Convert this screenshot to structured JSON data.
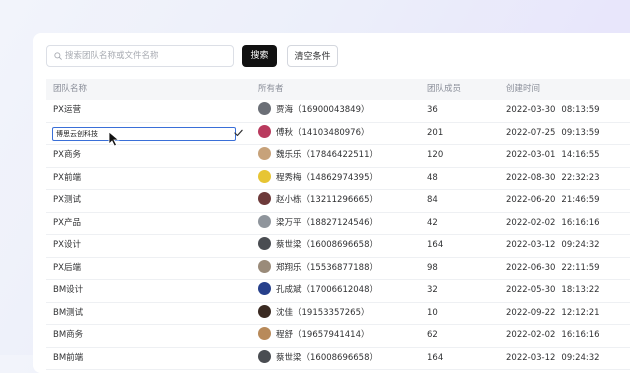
{
  "search": {
    "placeholder": "搜索团队名称或文件名称",
    "search_label": "搜索",
    "clear_label": "清空条件"
  },
  "table": {
    "headers": [
      "团队名称",
      "所有者",
      "团队成员",
      "创建时间"
    ],
    "editing_value": "博思云创科技",
    "rows": [
      {
        "name": "PX运营",
        "owner": "贾海（16900043849）",
        "members": "36",
        "date": "2022-03-30",
        "time": "08:13:59",
        "avatar": "#6b6f76"
      },
      {
        "name": "",
        "owner": "傅秋（14103480976）",
        "members": "201",
        "date": "2022-07-25",
        "time": "09:13:59",
        "avatar": "#b93a5e",
        "editing": true
      },
      {
        "name": "PX商务",
        "owner": "魏乐乐（17846422511）",
        "members": "120",
        "date": "2022-03-01",
        "time": "14:16:55",
        "avatar": "#c7a27a"
      },
      {
        "name": "PX前端",
        "owner": "程秀梅（14862974395）",
        "members": "48",
        "date": "2022-08-30",
        "time": "22:32:23",
        "avatar": "#e7c534"
      },
      {
        "name": "PX测试",
        "owner": "赵小栋（13211296665）",
        "members": "84",
        "date": "2022-06-20",
        "time": "21:46:59",
        "avatar": "#6d3a3a"
      },
      {
        "name": "PX产品",
        "owner": "梁万平（18827124546）",
        "members": "42",
        "date": "2022-02-02",
        "time": "16:16:16",
        "avatar": "#8f959c"
      },
      {
        "name": "PX设计",
        "owner": "蔡世梁（16008696658）",
        "members": "164",
        "date": "2022-03-12",
        "time": "09:24:32",
        "avatar": "#4a4d52"
      },
      {
        "name": "PX后端",
        "owner": "郑翔乐（15536877188）",
        "members": "98",
        "date": "2022-06-30",
        "time": "22:11:59",
        "avatar": "#9a8b7a"
      },
      {
        "name": "BM设计",
        "owner": "孔成斌（17006612048）",
        "members": "32",
        "date": "2022-05-30",
        "time": "18:13:22",
        "avatar": "#27408b"
      },
      {
        "name": "BM测试",
        "owner": "沈佳（19153357265）",
        "members": "10",
        "date": "2022-09-22",
        "time": "12:12:21",
        "avatar": "#3a2a22"
      },
      {
        "name": "BM商务",
        "owner": "程舒（19657941414）",
        "members": "62",
        "date": "2022-02-02",
        "time": "16:16:16",
        "avatar": "#b88a5a"
      },
      {
        "name": "BM前端",
        "owner": "蔡世梁（16008696658）",
        "members": "164",
        "date": "2022-03-12",
        "time": "09:24:32",
        "avatar": "#4a4d52"
      }
    ]
  }
}
